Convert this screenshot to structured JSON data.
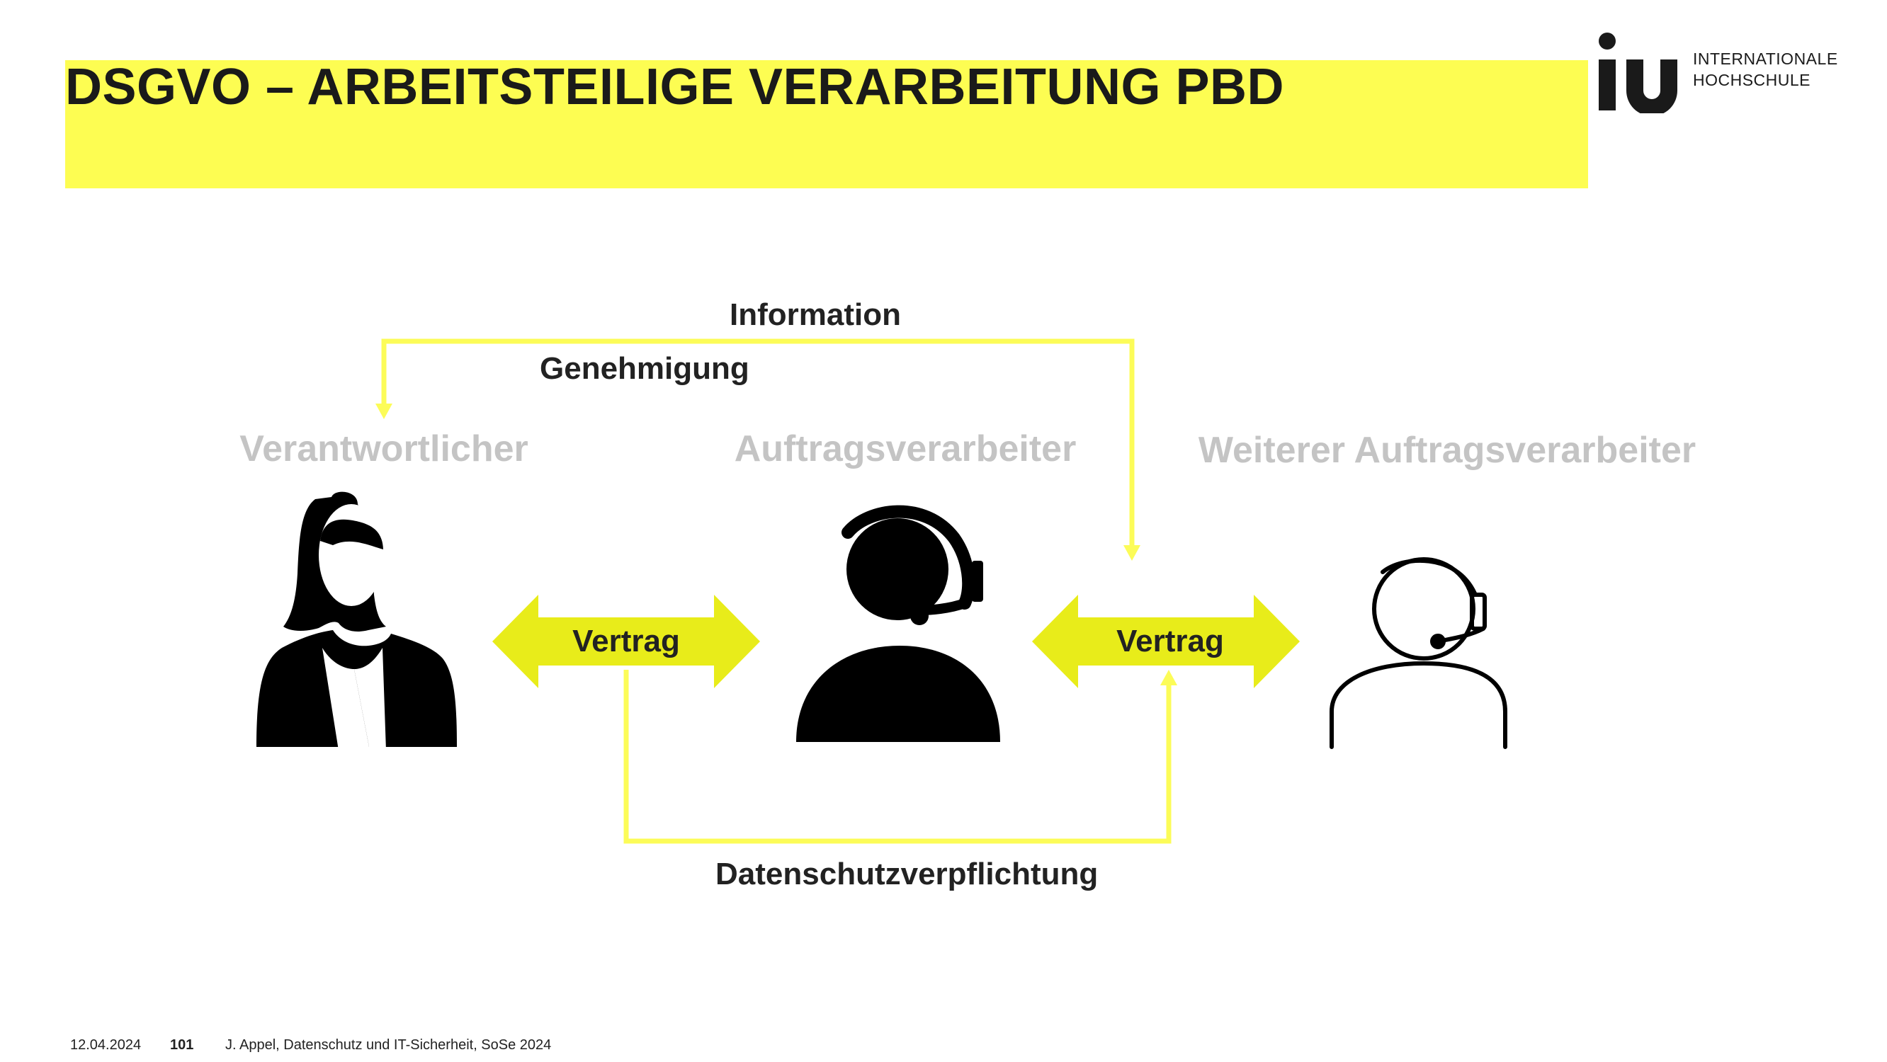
{
  "header": {
    "title": "DSGVO –  ARBEITSTEILIGE VERARBEITUNG PBD",
    "band_color": "#fdfd52"
  },
  "logo": {
    "mark": "iu",
    "line1": "INTERNATIONALE",
    "line2": "HOCHSCHULE"
  },
  "diagram": {
    "flow_top_label": "Information",
    "flow_top_label2": "Genehmigung",
    "flow_bottom_label": "Datenschutzverpflichtung",
    "roles": [
      {
        "label": "Verantwortlicher",
        "icon": "woman-person-icon"
      },
      {
        "label": "Auftragsverarbeiter",
        "icon": "headset-agent-icon"
      },
      {
        "label": "Weiterer Auftragsverarbeiter",
        "icon": "headset-agent-outline-icon"
      }
    ],
    "contracts": [
      {
        "label": "Vertrag"
      },
      {
        "label": "Vertrag"
      }
    ],
    "arrow_color": "#e8ec1a",
    "line_color": "#fcfc58",
    "role_label_color": "#c4c4c4"
  },
  "footer": {
    "date": "12.04.2024",
    "page": "101",
    "source": "J. Appel, Datenschutz und IT-Sicherheit, SoSe 2024"
  }
}
